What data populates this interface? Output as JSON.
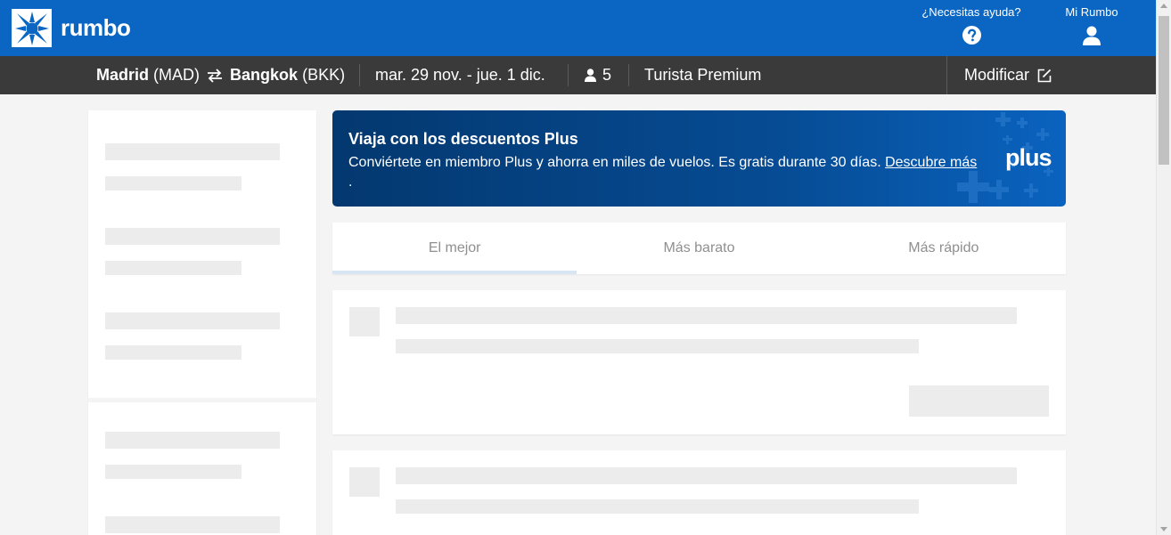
{
  "header": {
    "brand": "rumbo",
    "help_label": "¿Necesitas ayuda?",
    "account_label": "Mi Rumbo",
    "bg_color": "#0a66c2"
  },
  "search": {
    "origin_city": "Madrid",
    "origin_code": "(MAD)",
    "destination_city": "Bangkok",
    "destination_code": "(BKK)",
    "dates": "mar. 29 nov. - jue. 1 dic.",
    "passengers": "5",
    "cabin": "Turista Premium",
    "modify_label": "Modificar"
  },
  "promo": {
    "title": "Viaja con los descuentos Plus",
    "text": "Conviértete en miembro Plus y ahorra en miles de vuelos. Es gratis durante 30 días.",
    "link": "Descubre más",
    "trailing": ".",
    "logo": "plus"
  },
  "tabs": [
    {
      "label": "El mejor",
      "active": true
    },
    {
      "label": "Más barato",
      "active": false
    },
    {
      "label": "Más rápido",
      "active": false
    }
  ]
}
